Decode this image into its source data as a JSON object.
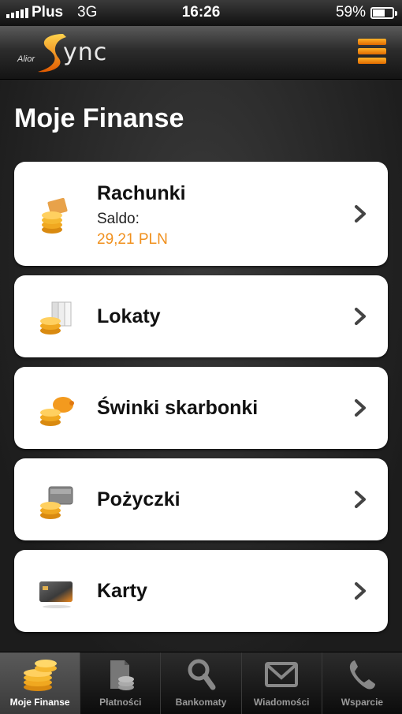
{
  "status_bar": {
    "carrier": "Plus",
    "network": "3G",
    "time": "16:26",
    "battery": "59%",
    "battery_level": 0.59
  },
  "header": {
    "logo_brand": "Alior",
    "logo_name": "ync"
  },
  "page_title": "Moje Finanse",
  "cards": [
    {
      "label": "Rachunki",
      "sub": "Saldo:",
      "amount": "29,21 PLN",
      "icon": "coins-wallet-icon"
    },
    {
      "label": "Lokaty",
      "icon": "coins-document-icon"
    },
    {
      "label": "Świnki skarbonki",
      "icon": "piggy-bank-icon"
    },
    {
      "label": "Pożyczki",
      "icon": "coins-wallet-icon"
    },
    {
      "label": "Karty",
      "icon": "credit-card-icon"
    }
  ],
  "tabs": [
    {
      "label": "Moje Finanse",
      "icon": "coins-icon",
      "active": true
    },
    {
      "label": "Płatności",
      "icon": "payments-icon",
      "active": false
    },
    {
      "label": "Bankomaty",
      "icon": "search-icon",
      "active": false
    },
    {
      "label": "Wiadomości",
      "icon": "envelope-icon",
      "active": false
    },
    {
      "label": "Wsparcie",
      "icon": "phone-icon",
      "active": false
    }
  ],
  "colors": {
    "accent": "#f0901e",
    "amount": "#f0901e",
    "card_bg": "#ffffff"
  }
}
